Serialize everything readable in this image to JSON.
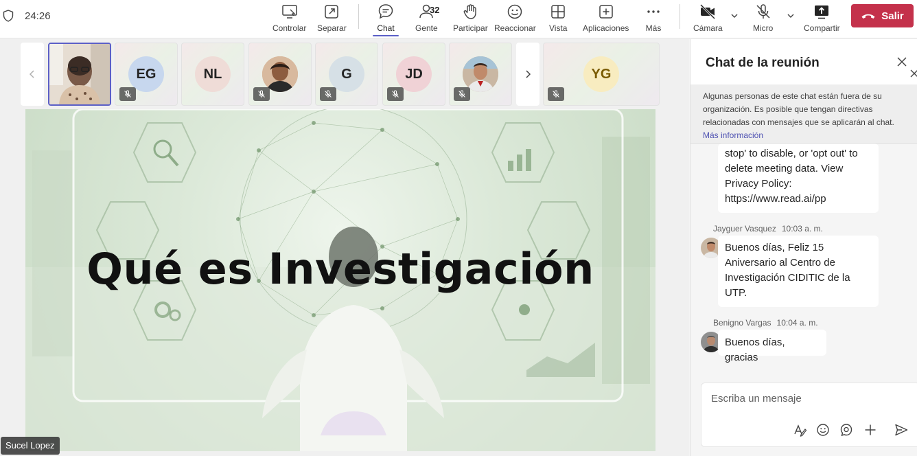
{
  "meeting": {
    "timer": "24:26"
  },
  "toolbar": {
    "controlar": "Controlar",
    "separar": "Separar",
    "chat": "Chat",
    "gente": "Gente",
    "gente_count": "32",
    "participar": "Participar",
    "reaccionar": "Reaccionar",
    "vista": "Vista",
    "aplicaciones": "Aplicaciones",
    "mas": "Más",
    "camara": "Cámara",
    "micro": "Micro",
    "compartir": "Compartir",
    "salir": "Salir"
  },
  "participants": [
    {
      "initials": "",
      "type": "video",
      "active": true,
      "muted": false,
      "color": "#d8d0c8"
    },
    {
      "initials": "EG",
      "type": "initials",
      "muted": true,
      "color": "#c7d7ee"
    },
    {
      "initials": "NL",
      "type": "initials",
      "muted": false,
      "color": "#efdcd7"
    },
    {
      "initials": "",
      "type": "photo",
      "muted": true,
      "color": "#c89a7c"
    },
    {
      "initials": "G",
      "type": "initials",
      "muted": true,
      "color": "#d6e0e6"
    },
    {
      "initials": "JD",
      "type": "initials",
      "muted": true,
      "color": "#f0d2d6"
    },
    {
      "initials": "",
      "type": "photo",
      "muted": true,
      "color": "#b9a999"
    },
    {
      "initials": "YG",
      "type": "initials",
      "muted": true,
      "color": "#f8ecc0"
    }
  ],
  "slide": {
    "title": "Qué es Investigación"
  },
  "presenter": {
    "name": "Sucel Lopez"
  },
  "chat": {
    "title": "Chat de la reunión",
    "notice": "Algunas personas de este chat están fuera de su organización. Es posible que tengan directivas relacionadas con mensajes que se aplicarán al chat.",
    "notice_link": "Más información",
    "messages": [
      {
        "sender": "",
        "time": "",
        "text": "stop' to disable, or 'opt out' to delete meeting data. View Privacy Policy: https://www.read.ai/pp"
      },
      {
        "sender": "Jayguer Vasquez",
        "time": "10:03 a. m.",
        "text": "Buenos días, Feliz 15 Aniversario al Centro de Investigación CIDITIC de la UTP."
      },
      {
        "sender": "Benigno Vargas",
        "time": "10:04 a. m.",
        "text": "Buenos días, gracias"
      }
    ],
    "compose_placeholder": "Escriba un mensaje"
  },
  "colors": {
    "accent": "#5b5fc7",
    "leave": "#c4314b",
    "link": "#4f52b2"
  },
  "icons": [
    "shield-icon",
    "share-screen-icon",
    "popout-icon",
    "chat-icon",
    "people-icon",
    "raise-hand-icon",
    "reaction-icon",
    "view-icon",
    "apps-icon",
    "more-icon",
    "camera-off-icon",
    "mic-off-icon",
    "share-icon",
    "phone-hangup-icon",
    "close-icon",
    "format-icon",
    "emoji-icon",
    "loop-icon",
    "plus-icon",
    "send-icon"
  ]
}
